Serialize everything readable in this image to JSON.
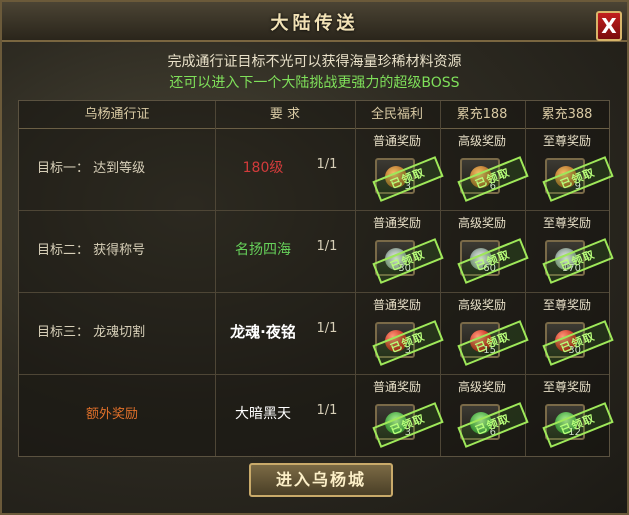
{
  "window": {
    "title": "大陆传送",
    "close_label": "X"
  },
  "description": {
    "line1": "完成通行证目标不光可以获得海量珍稀材料资源",
    "line2": "还可以进入下一个大陆挑战更强力的超级BOSS"
  },
  "table": {
    "headers": {
      "pass": "乌杨通行证",
      "requirement": "要  求",
      "tier1": "全民福利",
      "tier2": "累充188",
      "tier3": "累充388"
    },
    "reward_labels": {
      "tier1": "普通奖励",
      "tier2": "高级奖励",
      "tier3": "至尊奖励"
    },
    "rows": [
      {
        "goal": "目标一：  达到等级",
        "requirement": "180级",
        "progress": "1/1",
        "rewards": [
          {
            "icon": "bag-icon",
            "count": "3",
            "stamp": "已领取"
          },
          {
            "icon": "bag-icon",
            "count": "6",
            "stamp": "已领取"
          },
          {
            "icon": "bag-icon",
            "count": "9",
            "stamp": "已领取"
          }
        ]
      },
      {
        "goal": "目标二：  获得称号",
        "requirement": "名扬四海",
        "progress": "1/1",
        "rewards": [
          {
            "icon": "flower-icon",
            "count": "30",
            "stamp": "已领取"
          },
          {
            "icon": "flower-icon",
            "count": "60",
            "stamp": "已领取"
          },
          {
            "icon": "flower-icon",
            "count": "170",
            "stamp": "已领取"
          }
        ]
      },
      {
        "goal": "目标三：  龙魂切割",
        "requirement": "龙魂·夜铭",
        "progress": "1/1",
        "rewards": [
          {
            "icon": "apple-icon",
            "count": "3",
            "stamp": "已领取"
          },
          {
            "icon": "apple-icon",
            "count": "15",
            "stamp": "已领取"
          },
          {
            "icon": "apple-icon",
            "count": "30",
            "stamp": "已领取"
          }
        ]
      },
      {
        "goal": "额外奖励",
        "requirement": "大暗黑天",
        "progress": "1/1",
        "rewards": [
          {
            "icon": "green-item-icon",
            "count": "3",
            "stamp": "已领取"
          },
          {
            "icon": "green-item-icon",
            "count": "6",
            "stamp": "已领取"
          },
          {
            "icon": "green-item-icon",
            "count": "12",
            "stamp": "已领取"
          }
        ]
      }
    ]
  },
  "enter_button": "进入乌杨城",
  "colors": {
    "requirement_red": "#d23b3b",
    "requirement_green": "#66d15a",
    "requirement_white": "#ffffff",
    "extra_reward_orange": "#e0702a",
    "stamp_green": "#9fe85a"
  }
}
